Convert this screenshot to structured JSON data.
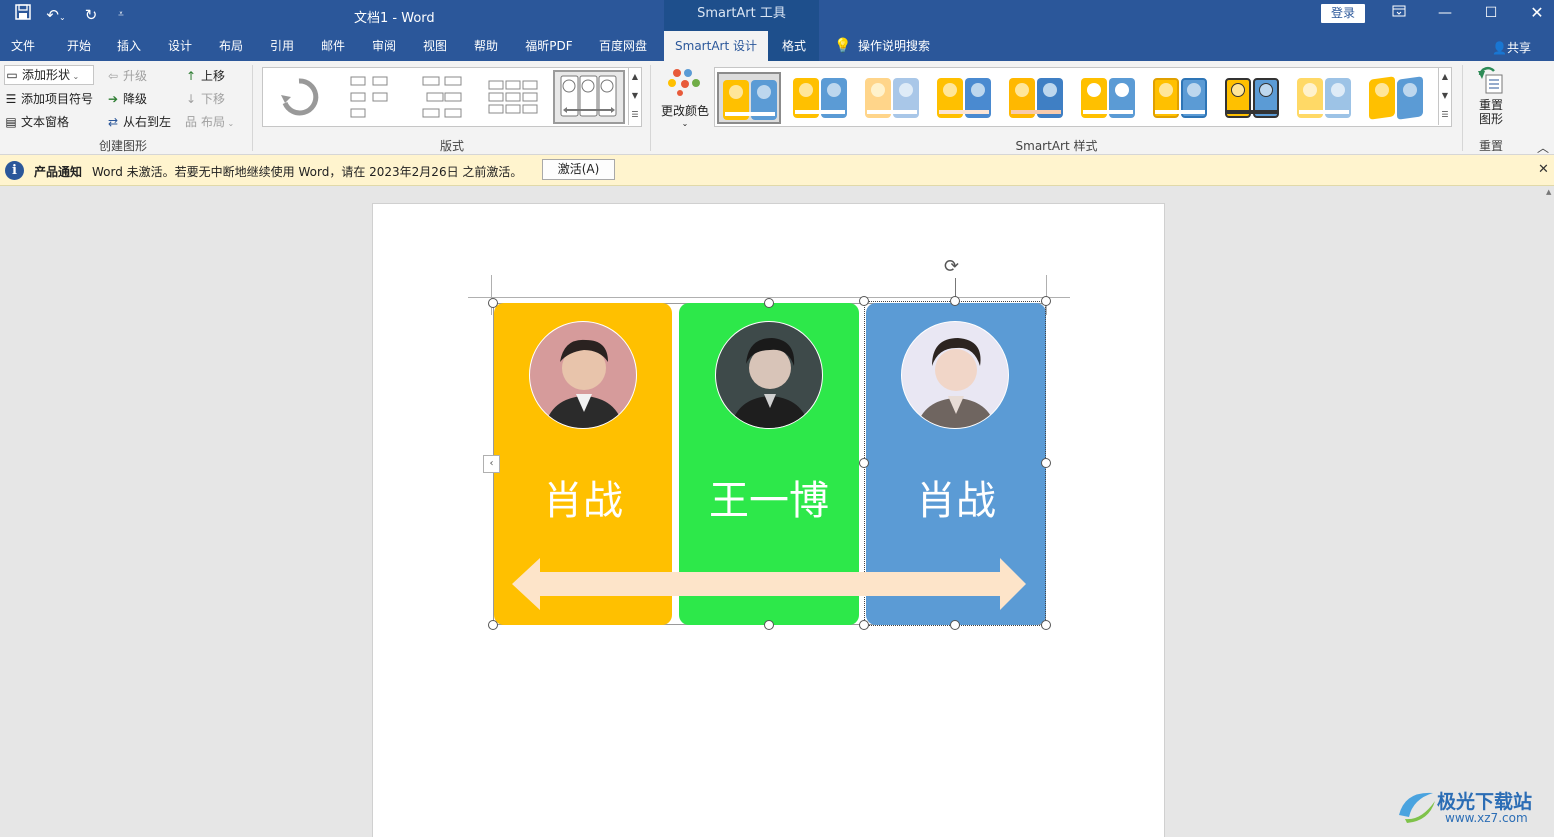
{
  "window": {
    "doc_title": "文档1  -  Word",
    "contextual_tool": "SmartArt 工具",
    "login": "登录"
  },
  "tabs": [
    "文件",
    "开始",
    "插入",
    "设计",
    "布局",
    "引用",
    "邮件",
    "审阅",
    "视图",
    "帮助",
    "福昕PDF",
    "百度网盘",
    "SmartArt 设计",
    "格式"
  ],
  "tell_me": "操作说明搜索",
  "share": "共享",
  "ribbon": {
    "create_graphic": {
      "add_shape": "添加形状",
      "add_bullet": "添加项目符号",
      "text_pane": "文本窗格",
      "promote": "升级",
      "demote": "降级",
      "right_to_left": "从右到左",
      "move_up": "上移",
      "move_down": "下移",
      "layout": "布局",
      "label": "创建图形"
    },
    "layouts_label": "版式",
    "change_colors": "更改颜色",
    "styles_label": "SmartArt 样式",
    "reset_graphic_line1": "重置",
    "reset_graphic_line2": "图形",
    "reset_label": "重置"
  },
  "notification": {
    "title": "产品通知",
    "message": "Word 未激活。若要无中断地继续使用 Word，请在 2023年2月26日 之前激活。",
    "button": "激活(A)"
  },
  "smartart": {
    "items": [
      {
        "name": "肖战",
        "color": "#ffc000"
      },
      {
        "name": "王一博",
        "color": "#2de84a"
      },
      {
        "name": "肖战",
        "color": "#5b9bd5"
      }
    ],
    "arrow_color": "#fde4c9"
  },
  "watermark": {
    "brand": "极光下载站",
    "url": "www.xz7.com"
  }
}
